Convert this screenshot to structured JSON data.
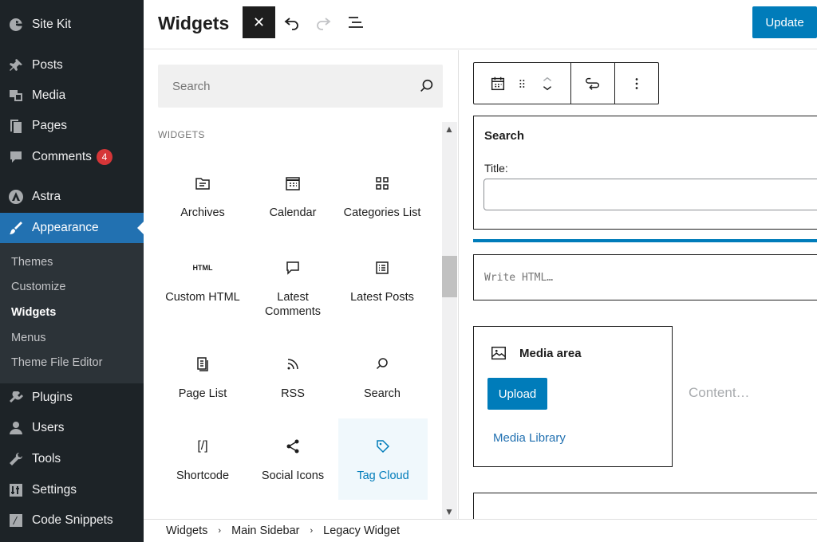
{
  "sidebar": {
    "site_kit": "Site Kit",
    "posts": "Posts",
    "media": "Media",
    "pages": "Pages",
    "comments": "Comments",
    "comments_badge": "4",
    "astra": "Astra",
    "appearance": "Appearance",
    "submenu": {
      "themes": "Themes",
      "customize": "Customize",
      "widgets": "Widgets",
      "menus": "Menus",
      "theme_file_editor": "Theme File Editor"
    },
    "plugins": "Plugins",
    "users": "Users",
    "tools": "Tools",
    "settings": "Settings",
    "code_snippets": "Code Snippets"
  },
  "header": {
    "title": "Widgets",
    "close_symbol": "✕",
    "update_label": "Update"
  },
  "inserter": {
    "search_placeholder": "Search",
    "section_label": "WIDGETS",
    "blocks": {
      "archives": "Archives",
      "calendar": "Calendar",
      "categories_list": "Categories List",
      "custom_html": "Custom HTML",
      "custom_html_icon_text": "HTML",
      "latest_comments": "Latest Comments",
      "latest_posts": "Latest Posts",
      "page_list": "Page List",
      "rss": "RSS",
      "search": "Search",
      "shortcode": "Shortcode",
      "shortcode_icon_text": "[/]",
      "social_icons": "Social Icons",
      "tag_cloud": "Tag Cloud"
    }
  },
  "editor": {
    "search_widget_title": "Search",
    "search_widget_label": "Title:",
    "html_placeholder": "Write HTML…",
    "media_area_title": "Media area",
    "upload_label": "Upload",
    "media_library_label": "Media Library",
    "content_placeholder": "Content…"
  },
  "breadcrumb": {
    "items": [
      "Widgets",
      "Main Sidebar",
      "Legacy Widget"
    ]
  },
  "colors": {
    "sidebar_bg": "#1d2327",
    "accent": "#2271b1",
    "button_blue": "#007cba",
    "badge_red": "#d63638"
  }
}
